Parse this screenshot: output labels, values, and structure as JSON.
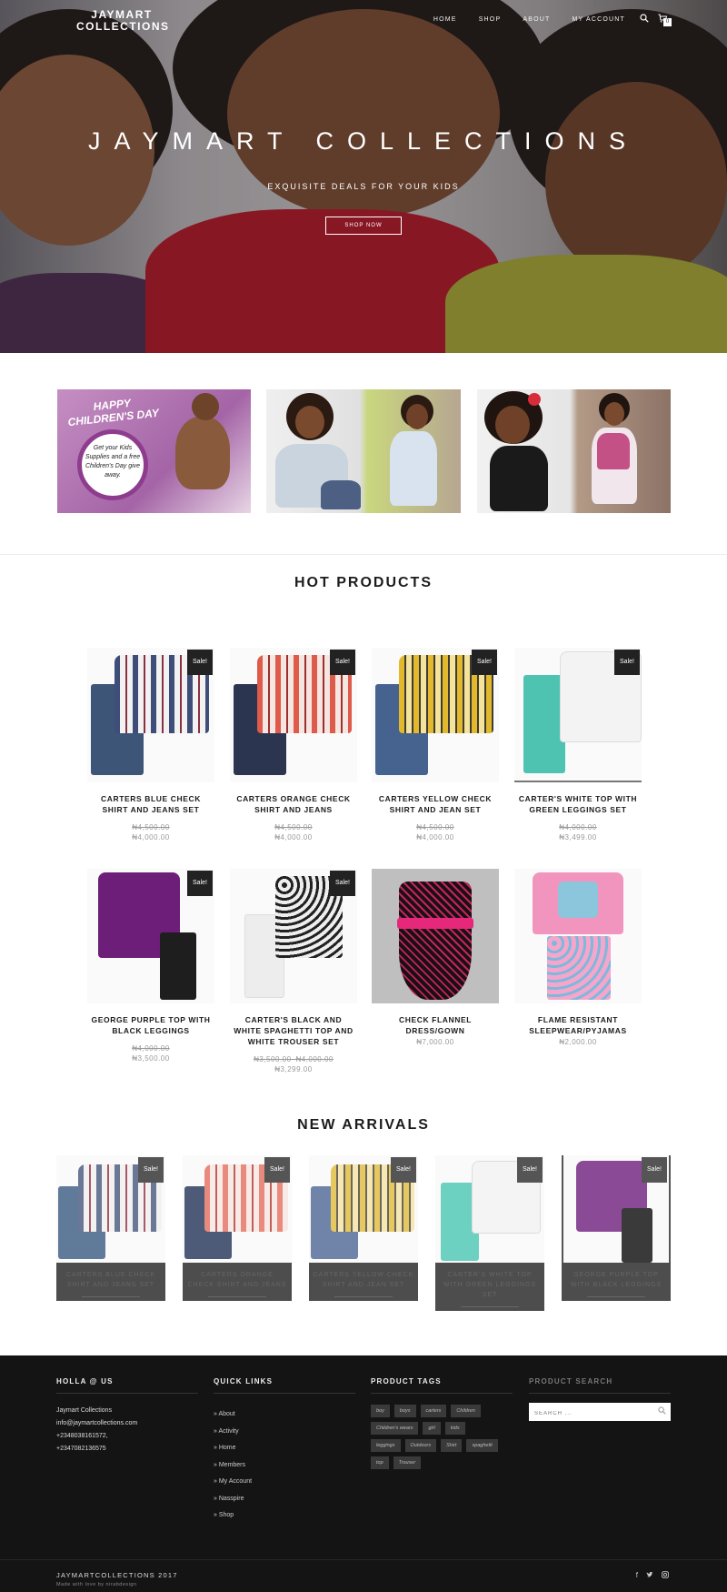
{
  "header": {
    "brand_line1": "JAYMART",
    "brand_line2": "COLLECTIONS",
    "nav": [
      "HOME",
      "SHOP",
      "ABOUT",
      "MY ACCOUNT"
    ],
    "cart_count": "0",
    "icons": {
      "search": "search-icon",
      "cart": "cart-icon"
    }
  },
  "hero": {
    "title": "JAYMART COLLECTIONS",
    "subtitle": "EXQUISITE DEALS FOR YOUR KIDS",
    "button": "SHOP NOW"
  },
  "promo": {
    "banner1_title": "HAPPY CHILDREN'S DAY",
    "banner1_text": "Get your Kids Supplies and a free Children's Day give away."
  },
  "hot_products": {
    "title": "HOT PRODUCTS",
    "sale_label": "Sale!",
    "items": [
      {
        "name": "CARTERS BLUE CHECK SHIRT AND JEANS SET",
        "old": "₦4,500.00",
        "price": "₦4,000.00",
        "sale": true
      },
      {
        "name": "CARTERS ORANGE CHECK SHIRT AND JEANS",
        "old": "₦4,500.00",
        "price": "₦4,000.00",
        "sale": true
      },
      {
        "name": "CARTERS YELLOW CHECK SHIRT AND JEAN SET",
        "old": "₦4,500.00",
        "price": "₦4,000.00",
        "sale": true
      },
      {
        "name": "CARTER'S WHITE TOP WITH GREEN LEGGINGS SET",
        "old": "₦4,000.00",
        "price": "₦3,499.00",
        "sale": true
      },
      {
        "name": "GEORGE PURPLE TOP WITH BLACK LEGGINGS",
        "old": "₦4,000.00",
        "price": "₦3,500.00",
        "sale": true
      },
      {
        "name": "CARTER'S BLACK AND WHITE SPAGHETTI TOP AND WHITE TROUSER SET",
        "old": "₦3,500.00–₦4,000.00",
        "price": "₦3,299.00",
        "sale": true
      },
      {
        "name": "CHECK FLANNEL DRESS/GOWN",
        "old": "",
        "price": "₦7,000.00",
        "sale": false
      },
      {
        "name": "FLAME RESISTANT SLEEPWEAR/PYJAMAS",
        "old": "",
        "price": "₦2,000.00",
        "sale": false
      }
    ]
  },
  "new_arrivals": {
    "title": "NEW ARRIVALS",
    "sale_label": "Sale!",
    "items": [
      {
        "caption": "CARTERS BLUE CHECK SHIRT AND JEANS SET"
      },
      {
        "caption": "CARTERS ORANGE CHECK SHIRT AND JEANS"
      },
      {
        "caption": "CARTERS YELLOW CHECK SHIRT AND JEAN SET"
      },
      {
        "caption": "CARTER'S WHITE TOP WITH GREEN LEGGINGS SET"
      },
      {
        "caption": "GEORGE PURPLE TOP WITH BLACK LEGGINGS"
      }
    ]
  },
  "footer": {
    "holla": {
      "title": "HOLLA @ US",
      "lines": [
        "Jaymart Collections",
        "info@jaymartcollections.com",
        "+2348038161572,",
        "+2347082136575"
      ]
    },
    "quick_links": {
      "title": "QUICK LINKS",
      "items": [
        "About",
        "Activity",
        "Home",
        "Members",
        "My Account",
        "Nasspire",
        "Shop"
      ]
    },
    "product_tags": {
      "title": "PRODUCT TAGS",
      "items": [
        "boy",
        "boys",
        "carters",
        "Children",
        "Children's wears",
        "girl",
        "kids",
        "leggings",
        "Outdoors",
        "Shirt",
        "spaghetti",
        "top",
        "Trouser"
      ]
    },
    "product_search": {
      "title": "PRODUCT SEARCH",
      "placeholder": "SEARCH ..."
    },
    "copyright": "JAYMARTCOLLECTIONS 2017",
    "made_by": "Made with love by nirabdesign",
    "social": [
      "facebook-icon",
      "twitter-icon",
      "instagram-icon"
    ]
  },
  "colors": {
    "accent_dark": "#222222",
    "footer_bg": "#141414",
    "sale_badge": "#222222",
    "price_gray": "#999999"
  }
}
